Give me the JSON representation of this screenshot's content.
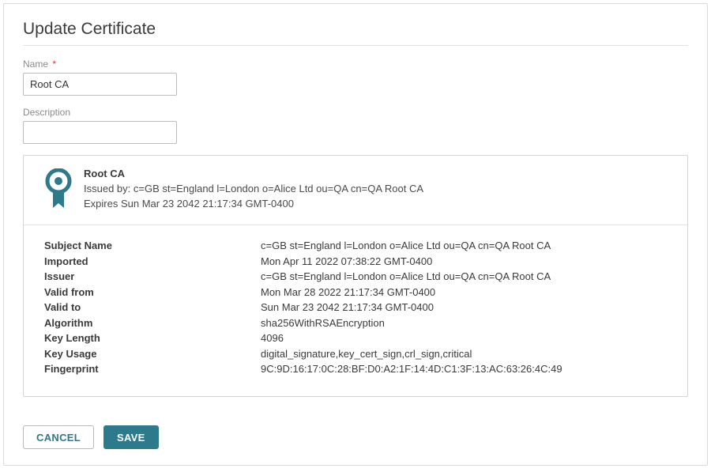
{
  "page_title": "Update Certificate",
  "fields": {
    "name_label": "Name",
    "name_required": "*",
    "name_value": "Root CA",
    "description_label": "Description",
    "description_value": ""
  },
  "cert": {
    "name": "Root CA",
    "issued_by_prefix": "Issued by: ",
    "issued_by": "c=GB st=England l=London o=Alice Ltd ou=QA cn=QA Root CA",
    "expires_prefix": "Expires ",
    "expires": "Sun Mar 23 2042 21:17:34 GMT-0400"
  },
  "details": [
    {
      "label": "Subject Name",
      "value": "c=GB st=England l=London o=Alice Ltd ou=QA cn=QA Root CA"
    },
    {
      "label": "Imported",
      "value": "Mon Apr 11 2022 07:38:22 GMT-0400"
    },
    {
      "label": "Issuer",
      "value": "c=GB st=England l=London o=Alice Ltd ou=QA cn=QA Root CA"
    },
    {
      "label": "Valid from",
      "value": "Mon Mar 28 2022 21:17:34 GMT-0400"
    },
    {
      "label": "Valid to",
      "value": "Sun Mar 23 2042 21:17:34 GMT-0400"
    },
    {
      "label": "Algorithm",
      "value": "sha256WithRSAEncryption"
    },
    {
      "label": "Key Length",
      "value": "4096"
    },
    {
      "label": "Key Usage",
      "value": "digital_signature,key_cert_sign,crl_sign,critical"
    },
    {
      "label": "Fingerprint",
      "value": "9C:9D:16:17:0C:28:BF:D0:A2:1F:14:4D:C1:3F:13:AC:63:26:4C:49"
    }
  ],
  "buttons": {
    "cancel": "CANCEL",
    "save": "SAVE"
  },
  "colors": {
    "accent": "#2c7a8c"
  }
}
